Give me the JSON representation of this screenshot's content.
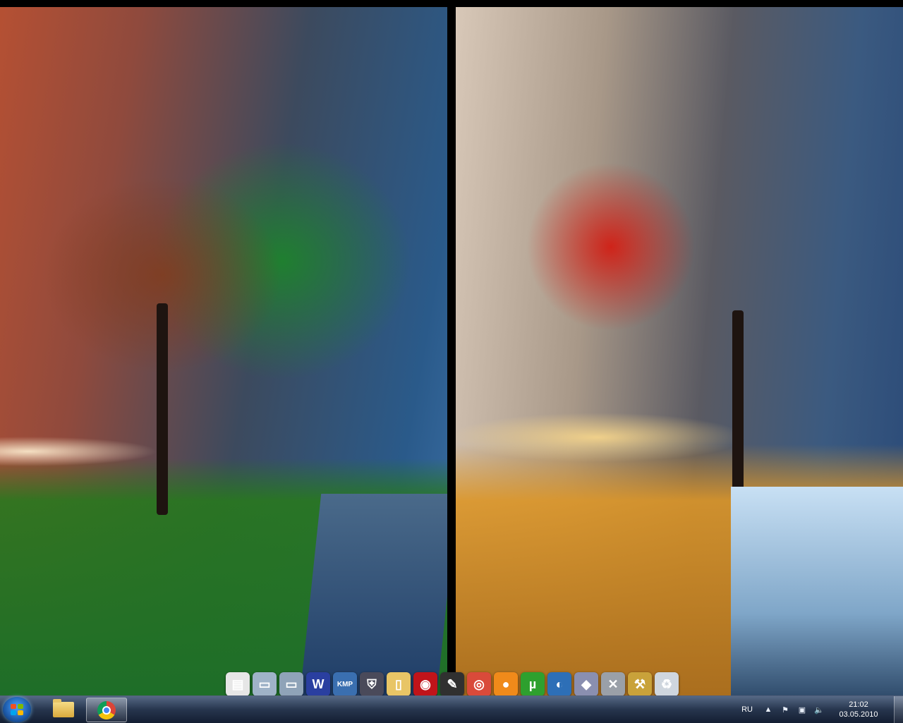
{
  "taskbar": {
    "language": "RU",
    "clock": {
      "time": "21:02",
      "date": "03.05.2010"
    },
    "pinned": [
      {
        "name": "windows-explorer",
        "icon": "folder-icon"
      },
      {
        "name": "google-chrome",
        "icon": "chrome-icon",
        "active": true
      }
    ],
    "tray_icons": [
      "chevron-up-icon",
      "network-icon",
      "volume-icon"
    ]
  },
  "dock": {
    "items": [
      {
        "icon": "document-icon",
        "glyph": "▤",
        "color": "#e6e6e6"
      },
      {
        "icon": "folder-stack-icon",
        "glyph": "▭",
        "color": "#9fb3c8"
      },
      {
        "icon": "folder-stack-icon",
        "glyph": "▭",
        "color": "#8fa3b8"
      },
      {
        "icon": "world-of-warcraft-icon",
        "glyph": "W",
        "color": "#2a3fa0"
      },
      {
        "icon": "kmplayer-icon",
        "glyph": "KMP",
        "color": "#3a6fb0"
      },
      {
        "icon": "shield-icon",
        "glyph": "⛨",
        "color": "#4a4a5a"
      },
      {
        "icon": "folder-icon",
        "glyph": "▯",
        "color": "#e8c566"
      },
      {
        "icon": "garena-icon",
        "glyph": "◉",
        "color": "#c0141a"
      },
      {
        "icon": "pen-tool-icon",
        "glyph": "✎",
        "color": "#303030"
      },
      {
        "icon": "chrome-icon",
        "glyph": "◎",
        "color": "#d94a3a"
      },
      {
        "icon": "orange-ball-icon",
        "glyph": "●",
        "color": "#f08a1a"
      },
      {
        "icon": "utorrent-icon",
        "glyph": "µ",
        "color": "#2ea02e"
      },
      {
        "icon": "headset-globe-icon",
        "glyph": "◐",
        "color": "#2d6fb7"
      },
      {
        "icon": "crystal-icon",
        "glyph": "◆",
        "color": "#8a8fb0"
      },
      {
        "icon": "tools-icon",
        "glyph": "✕",
        "color": "#9aa0a8"
      },
      {
        "icon": "hammer-icon",
        "glyph": "⚒",
        "color": "#c9a23a"
      },
      {
        "icon": "recycle-bin-icon",
        "glyph": "♻",
        "color": "#cfd6de"
      }
    ]
  }
}
